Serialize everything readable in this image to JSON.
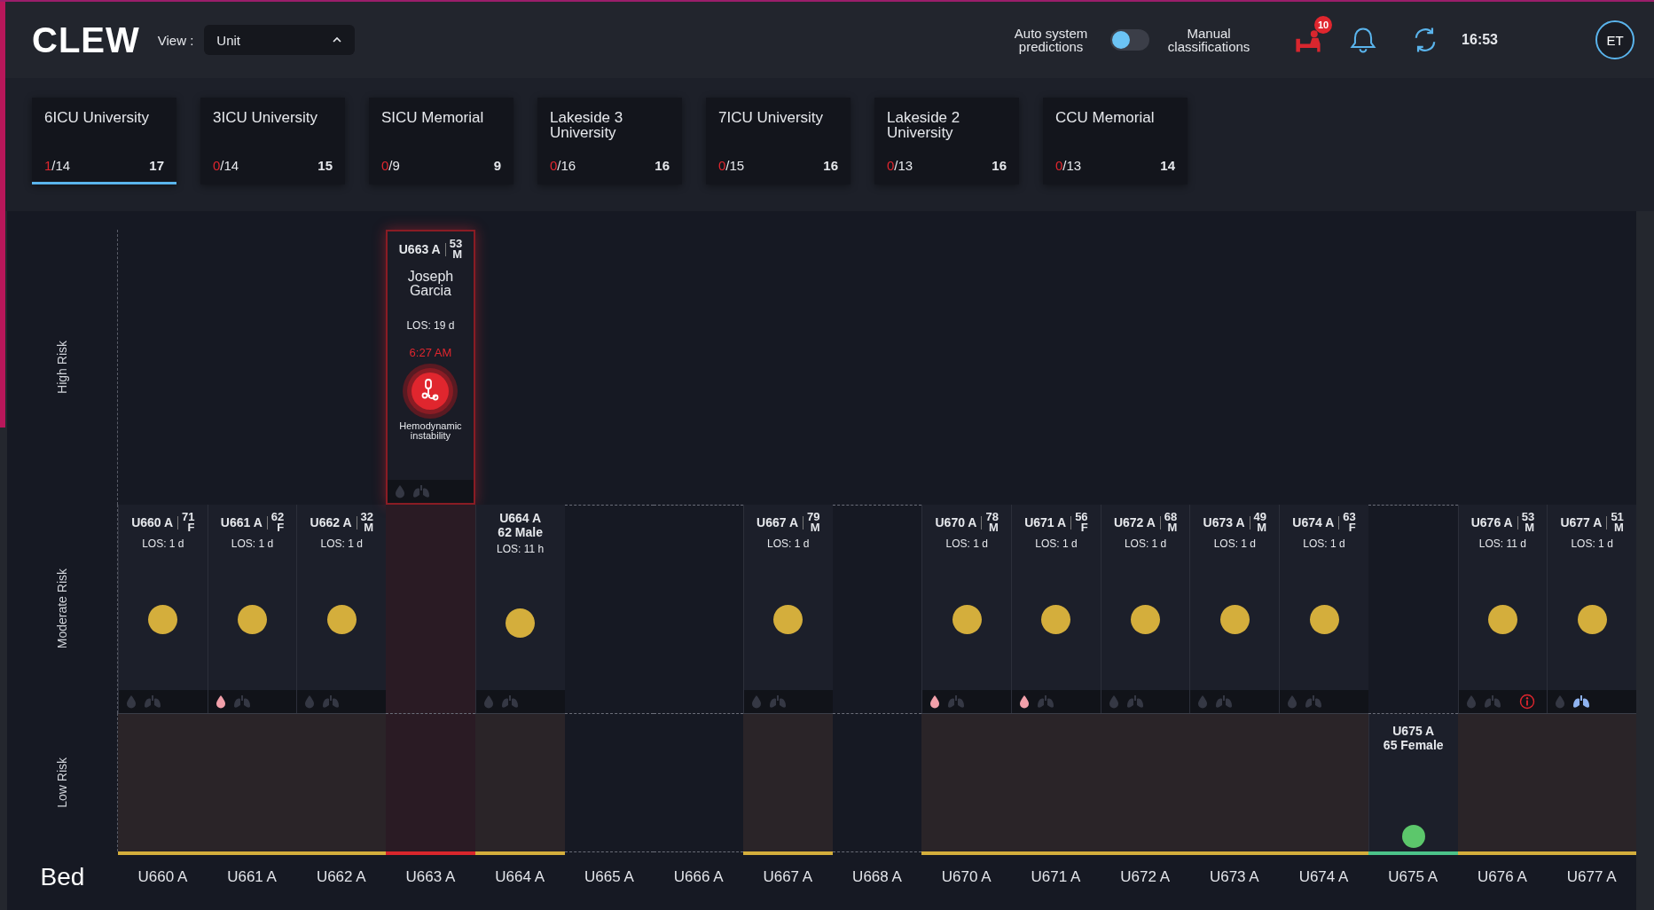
{
  "header": {
    "logo": "CLEW",
    "view_label": "View :",
    "view_value": "Unit",
    "auto_label": "Auto system predictions",
    "toggle": {
      "on": false
    },
    "manual_label": "Manual classifications",
    "alerts_badge": "10",
    "time": "16:53",
    "avatar": "ET"
  },
  "units": [
    {
      "name": "6ICU University",
      "flagged": "1",
      "capacity": "/14",
      "count": "17",
      "selected": true
    },
    {
      "name": "3ICU University",
      "flagged": "0",
      "capacity": "/14",
      "count": "15",
      "selected": false
    },
    {
      "name": "SICU Memorial",
      "flagged": "0",
      "capacity": "/9",
      "count": "9",
      "selected": false
    },
    {
      "name": "Lakeside 3 University",
      "flagged": "0",
      "capacity": "/16",
      "count": "16",
      "selected": false
    },
    {
      "name": "7ICU University",
      "flagged": "0",
      "capacity": "/15",
      "count": "16",
      "selected": false
    },
    {
      "name": "Lakeside 2 University",
      "flagged": "0",
      "capacity": "/13",
      "count": "16",
      "selected": false
    },
    {
      "name": "CCU Memorial",
      "flagged": "0",
      "capacity": "/13",
      "count": "14",
      "selected": false
    }
  ],
  "risk_levels": [
    "High Risk",
    "Moderate Risk",
    "Low Risk"
  ],
  "bed_heading": "Bed",
  "beds": [
    {
      "label": "U660 A",
      "kind": "moderate",
      "patient": {
        "bed": "U660 A",
        "age": "71",
        "sex": "F",
        "los": "LOS: 1 d",
        "indicators": [
          {
            "kind": "drop",
            "active": false
          },
          {
            "kind": "lungs",
            "active": false
          }
        ]
      }
    },
    {
      "label": "U661 A",
      "kind": "moderate",
      "patient": {
        "bed": "U661 A",
        "age": "62",
        "sex": "F",
        "los": "LOS: 1 d",
        "indicators": [
          {
            "kind": "drop",
            "active": true
          },
          {
            "kind": "lungs",
            "active": false
          }
        ]
      }
    },
    {
      "label": "U662 A",
      "kind": "moderate",
      "patient": {
        "bed": "U662 A",
        "age": "32",
        "sex": "M",
        "los": "LOS: 1 d",
        "indicators": [
          {
            "kind": "drop",
            "active": false
          },
          {
            "kind": "lungs",
            "active": false
          }
        ]
      }
    },
    {
      "label": "U663 A",
      "kind": "high",
      "patient": {
        "bed": "U663 A",
        "age": "53",
        "sex": "M",
        "name": "Joseph Garcia",
        "los": "LOS: 19 d",
        "time": "6:27 AM",
        "alert": "Hemodynamic instability",
        "indicators": [
          {
            "kind": "drop",
            "active": false
          },
          {
            "kind": "lungs",
            "active": false
          }
        ]
      }
    },
    {
      "label": "U664 A",
      "kind": "moderate",
      "patient": {
        "bed": "U664 A",
        "demographics": "62 Male",
        "los": "LOS: 11 h",
        "indicators": [
          {
            "kind": "drop",
            "active": false
          },
          {
            "kind": "lungs",
            "active": false
          }
        ]
      }
    },
    {
      "label": "U665 A",
      "kind": "empty"
    },
    {
      "label": "U666 A",
      "kind": "empty"
    },
    {
      "label": "U667 A",
      "kind": "moderate",
      "patient": {
        "bed": "U667 A",
        "age": "79",
        "sex": "M",
        "los": "LOS: 1 d",
        "indicators": [
          {
            "kind": "drop",
            "active": false
          },
          {
            "kind": "lungs",
            "active": false
          }
        ]
      }
    },
    {
      "label": "U668 A",
      "kind": "empty"
    },
    {
      "label": "U670 A",
      "kind": "moderate",
      "patient": {
        "bed": "U670 A",
        "age": "78",
        "sex": "M",
        "los": "LOS: 1 d",
        "indicators": [
          {
            "kind": "drop",
            "active": true
          },
          {
            "kind": "lungs",
            "active": false
          }
        ]
      }
    },
    {
      "label": "U671 A",
      "kind": "moderate",
      "patient": {
        "bed": "U671 A",
        "age": "56",
        "sex": "F",
        "los": "LOS: 1 d",
        "indicators": [
          {
            "kind": "drop",
            "active": true
          },
          {
            "kind": "lungs",
            "active": false
          }
        ]
      }
    },
    {
      "label": "U672 A",
      "kind": "moderate",
      "patient": {
        "bed": "U672 A",
        "age": "68",
        "sex": "M",
        "los": "LOS: 1 d",
        "indicators": [
          {
            "kind": "drop",
            "active": false
          },
          {
            "kind": "lungs",
            "active": false
          }
        ]
      }
    },
    {
      "label": "U673 A",
      "kind": "moderate",
      "patient": {
        "bed": "U673 A",
        "age": "49",
        "sex": "M",
        "los": "LOS: 1 d",
        "indicators": [
          {
            "kind": "drop",
            "active": false
          },
          {
            "kind": "lungs",
            "active": false
          }
        ]
      }
    },
    {
      "label": "U674 A",
      "kind": "moderate",
      "patient": {
        "bed": "U674 A",
        "age": "63",
        "sex": "F",
        "los": "LOS: 1 d",
        "indicators": [
          {
            "kind": "drop",
            "active": false
          },
          {
            "kind": "lungs",
            "active": false
          }
        ]
      }
    },
    {
      "label": "U675 A",
      "kind": "low",
      "patient": {
        "bed": "U675 A",
        "demographics": "65 Female"
      }
    },
    {
      "label": "U676 A",
      "kind": "moderate",
      "patient": {
        "bed": "U676 A",
        "age": "53",
        "sex": "M",
        "los": "LOS: 11 d",
        "indicators": [
          {
            "kind": "drop",
            "active": false
          },
          {
            "kind": "lungs",
            "active": false
          },
          {
            "kind": "info",
            "active": true
          }
        ]
      }
    },
    {
      "label": "U677 A",
      "kind": "moderate",
      "patient": {
        "bed": "U677 A",
        "age": "51",
        "sex": "M",
        "los": "LOS: 1 d",
        "indicators": [
          {
            "kind": "drop",
            "active": false
          },
          {
            "kind": "lungs",
            "active": true
          }
        ]
      }
    }
  ]
}
